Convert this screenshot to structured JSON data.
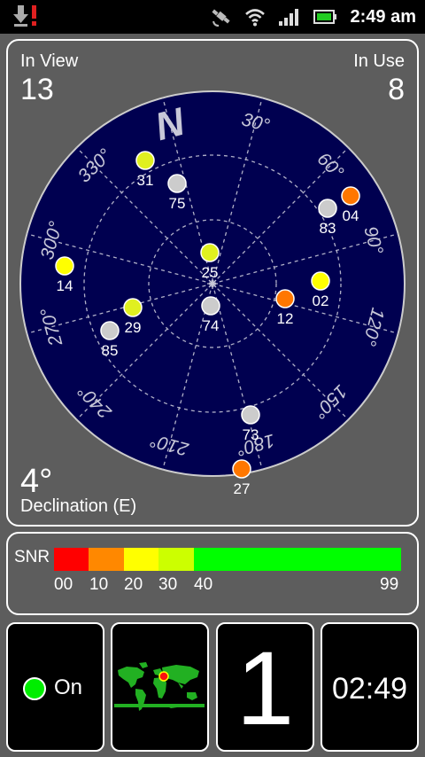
{
  "status_bar": {
    "time": "2:49 am",
    "icons": [
      "download-icon",
      "alert-icon",
      "gps-icon",
      "wifi-icon",
      "signal-icon",
      "battery-icon"
    ]
  },
  "sky": {
    "in_view_label": "In View",
    "in_view_value": "13",
    "in_use_label": "In Use",
    "in_use_value": "8",
    "north_label": "N",
    "declination_value": "4°",
    "declination_label": "Declination (E)",
    "degree_labels": [
      "30°",
      "60°",
      "90°",
      "120°",
      "150°",
      "180°",
      "210°",
      "240°",
      "270°",
      "300°",
      "330°"
    ],
    "satellites": [
      {
        "id": "31",
        "color": "#e0f020"
      },
      {
        "id": "75",
        "color": "#cccccc"
      },
      {
        "id": "04",
        "color": "#ff7700"
      },
      {
        "id": "83",
        "color": "#cccccc"
      },
      {
        "id": "25",
        "color": "#e0f020"
      },
      {
        "id": "14",
        "color": "#ffff00"
      },
      {
        "id": "02",
        "color": "#ffff00"
      },
      {
        "id": "12",
        "color": "#ff7700"
      },
      {
        "id": "29",
        "color": "#e0f020"
      },
      {
        "id": "74",
        "color": "#cccccc"
      },
      {
        "id": "85",
        "color": "#cccccc"
      },
      {
        "id": "73",
        "color": "#cccccc"
      },
      {
        "id": "27",
        "color": "#ff7700"
      }
    ]
  },
  "snr": {
    "label": "SNR",
    "ticks": [
      "00",
      "10",
      "20",
      "30",
      "40",
      "99"
    ],
    "segment_colors": [
      "#ff0000",
      "#ff8800",
      "#ffff00",
      "#ccff00",
      "#00ff00"
    ]
  },
  "tiles": {
    "gps_label": "On",
    "satellites_in_use": "1",
    "clock": "02:49"
  },
  "colors": {
    "sky_background": "#000050",
    "panel_background": "#5d5d5d"
  }
}
